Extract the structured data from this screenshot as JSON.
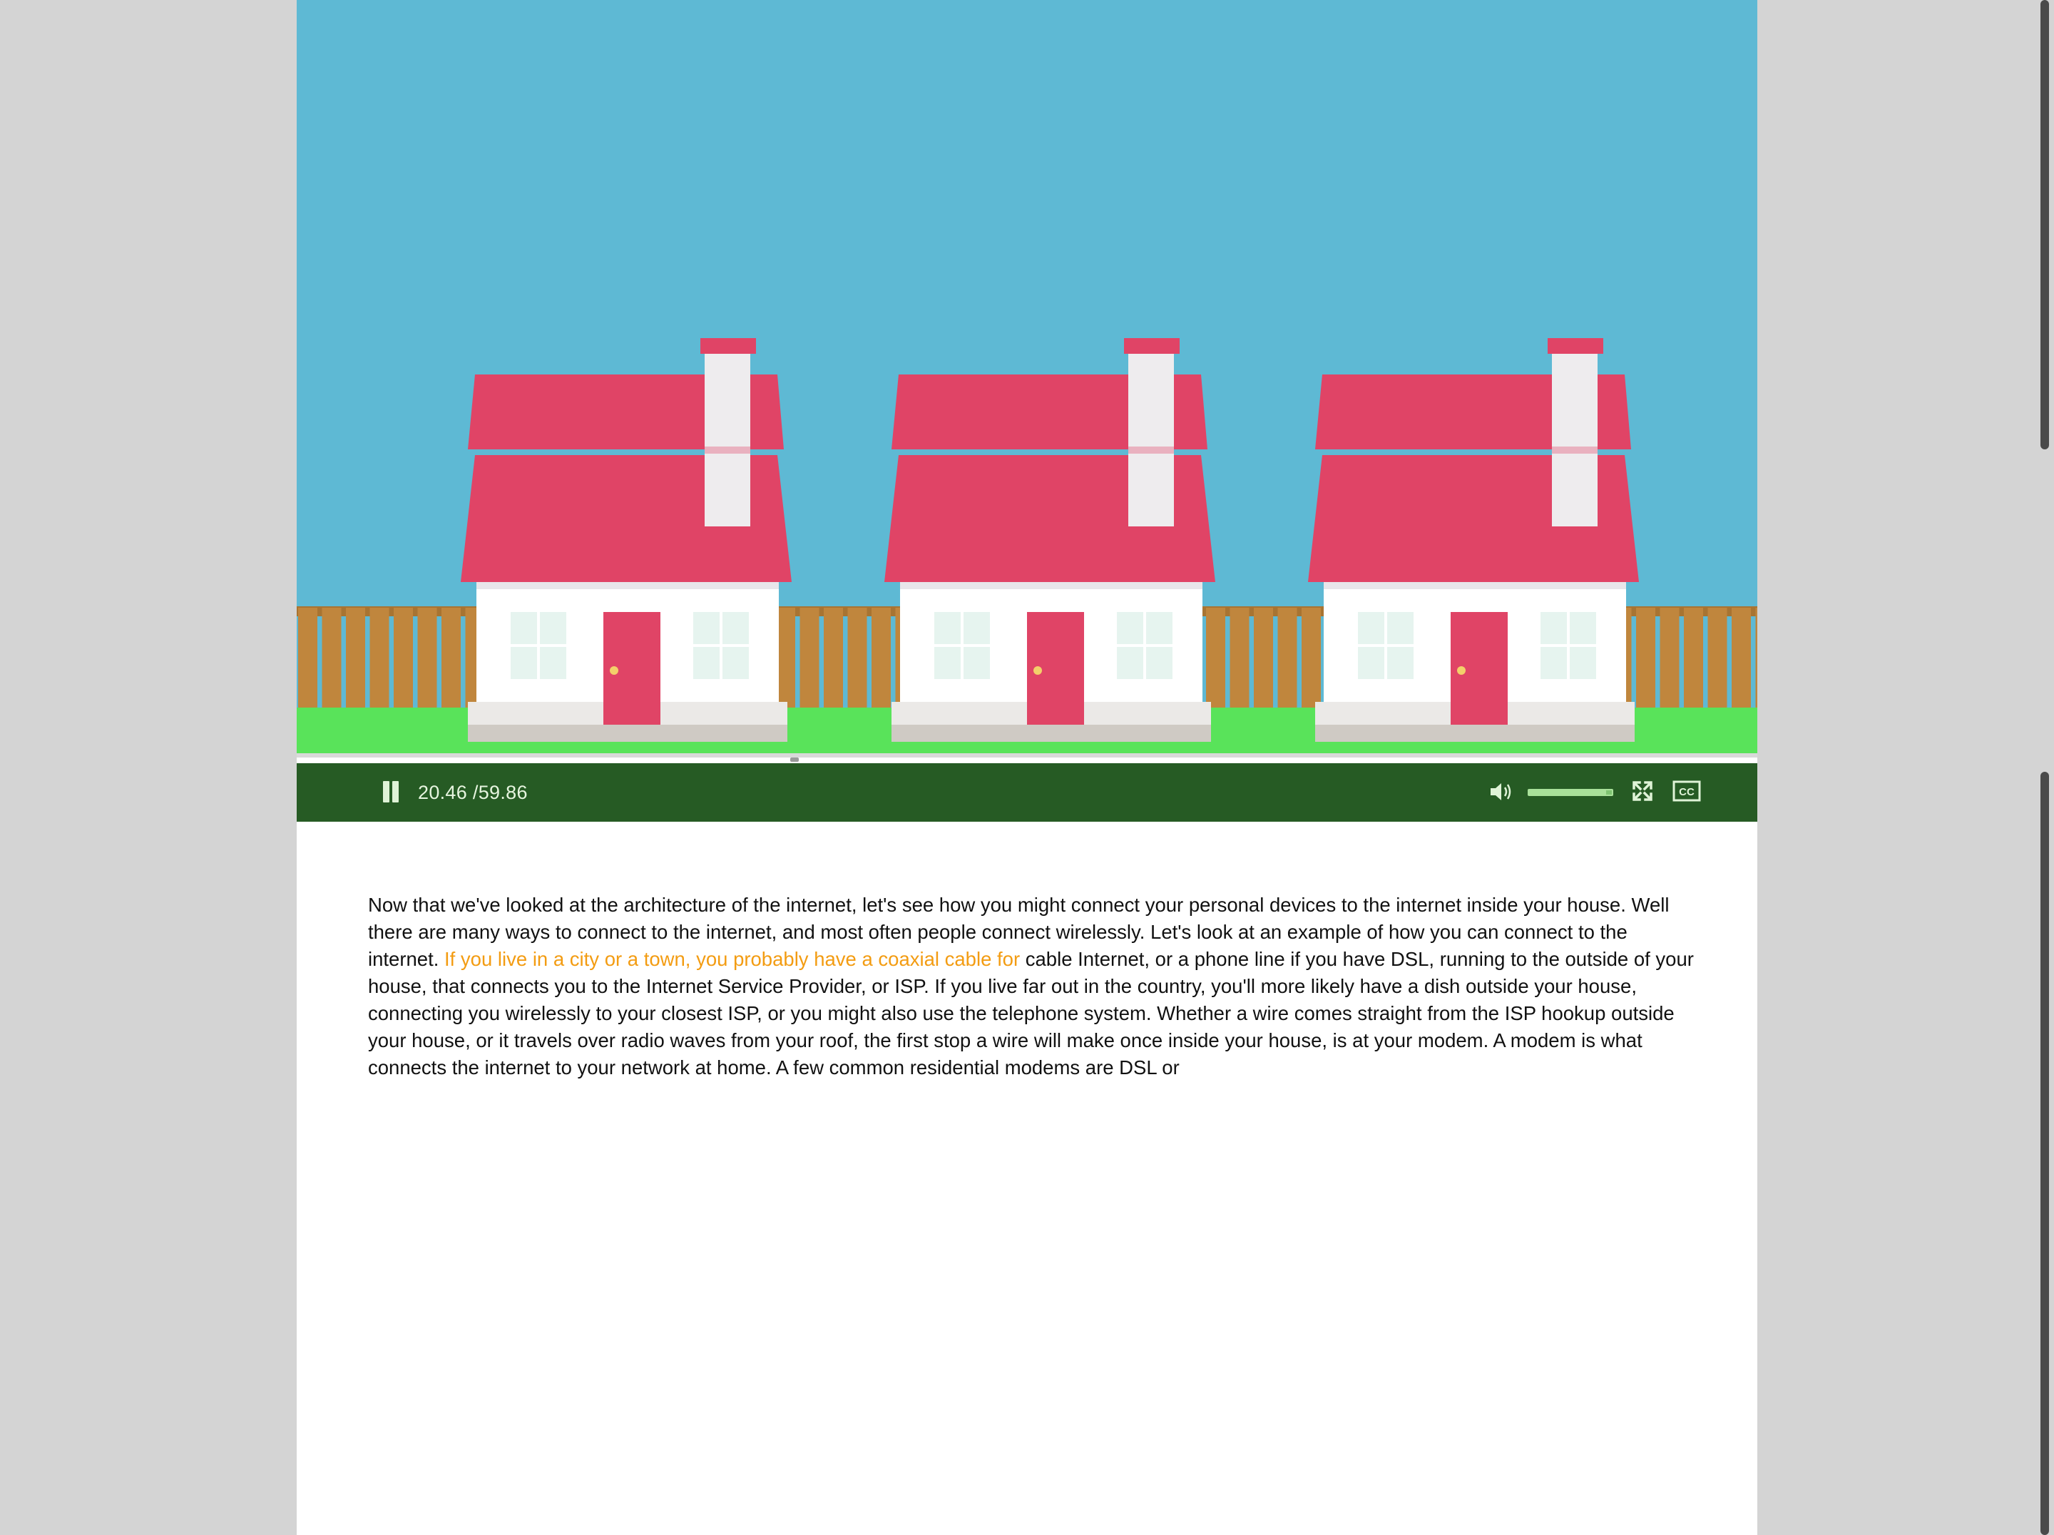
{
  "colors": {
    "sky": "#5eb9d4",
    "roof": "#e04466",
    "fence": "#c0863d",
    "grass": "#59e35a",
    "controls_bg": "#265b24",
    "highlight_text": "#f39c12"
  },
  "player": {
    "current_time": "20.46",
    "duration_text": "/59.86",
    "playing": true,
    "icons": [
      "pause-icon",
      "volume-icon",
      "fullscreen-icon",
      "closed-captions-icon"
    ],
    "cc_label": "CC"
  },
  "transcript": {
    "before_highlight": "Now that we've looked at the architecture of the internet, let's see how you might connect your personal devices to the internet inside your house. Well there are many ways to connect to the internet, and most often people connect wirelessly. Let's look at an example of how you can connect to the internet. ",
    "highlight": "If you live in a city or a town, you probably have a coaxial cable for",
    "after_highlight": " cable Internet, or a phone line if you have DSL, running to the outside of your house, that connects you to the Internet Service Provider, or ISP. If you live far out in the country, you'll more likely have a dish outside your house, connecting you wirelessly to your closest ISP, or you might also use the telephone system. Whether a wire comes straight from the ISP hookup outside your house, or it travels over radio waves from your roof, the first stop a wire will make once inside your house, is at your modem. A modem is what connects the internet to your network at home. A few common residential modems are DSL or"
  }
}
